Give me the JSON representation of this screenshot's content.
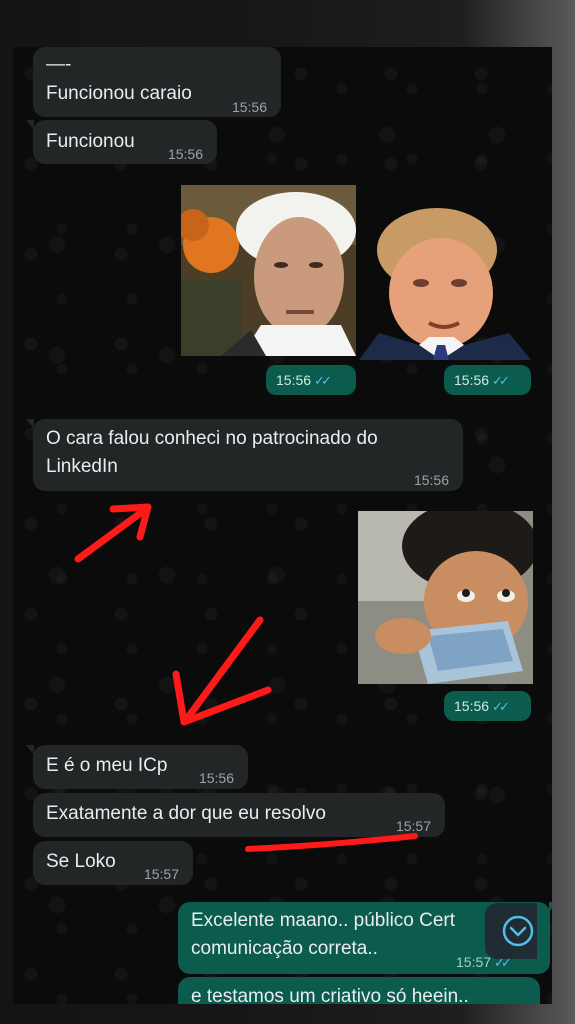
{
  "messages": {
    "m1": {
      "line1": "—-",
      "line2": "Funcionou caraio",
      "time": "15:56"
    },
    "m2": {
      "text": "Funcionou",
      "time": "15:56"
    },
    "sticker1": {
      "time": "15:56",
      "ticks": "✓✓"
    },
    "sticker2": {
      "time": "15:56",
      "ticks": "✓✓"
    },
    "m3": {
      "line1": "O cara falou conheci no patrocinado do",
      "line2": "LinkedIn",
      "time": "15:56"
    },
    "sticker3": {
      "time": "15:56",
      "ticks": "✓✓"
    },
    "m4": {
      "text": "E é o meu ICp",
      "time": "15:56"
    },
    "m5": {
      "text": "Exatamente a dor que eu resolvo",
      "time": "15:57"
    },
    "m6": {
      "text": "Se Loko",
      "time": "15:57"
    },
    "m7": {
      "line1": "Excelente maano.. público Cert",
      "line2": "comunicação correta..",
      "time": "15:57",
      "ticks": "✓✓"
    },
    "m8": {
      "text": "e testamos um criativo só heein.."
    }
  },
  "colors": {
    "incoming_bubble": "#232626",
    "outgoing_bubble": "#0c5c4e",
    "read_ticks": "#53bdeb",
    "annotation_red": "#ff1a1a"
  },
  "icons": [
    "chevron-down-icon",
    "double-check-icon"
  ]
}
